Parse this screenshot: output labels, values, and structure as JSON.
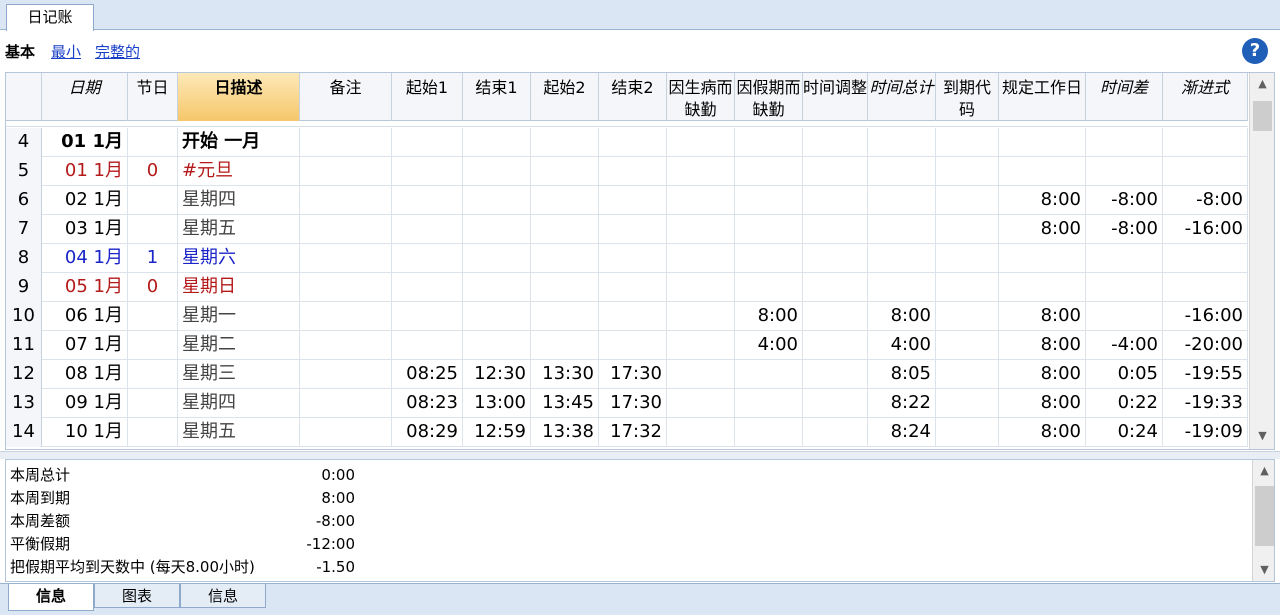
{
  "doc_tab": "日记账",
  "views": {
    "basic": "基本",
    "min": "最小",
    "full": "完整的"
  },
  "help_symbol": "?",
  "headers": {
    "date": "日期",
    "holiday": "节日",
    "desc": "日描述",
    "note": "备注",
    "start1": "起始1",
    "end1": "结束1",
    "start2": "起始2",
    "end2": "结束2",
    "sick": "因生病而缺勤",
    "vacation": "因假期而缺勤",
    "adjust": "时间调整",
    "total": "时间总计",
    "due_code": "到期代码",
    "workday": "规定工作日",
    "diff": "时间差",
    "progressive": "渐进式"
  },
  "rows": [
    {
      "num": "4",
      "date": "01 1月",
      "holiday": "",
      "desc": "开始 一月",
      "start1": "",
      "end1": "",
      "start2": "",
      "end2": "",
      "sick": "",
      "vacation": "",
      "adjust": "",
      "total": "",
      "due_code": "",
      "workday": "",
      "diff": "",
      "progressive": ""
    },
    {
      "num": "5",
      "date": "01 1月",
      "holiday": "0",
      "desc": "#元旦",
      "start1": "",
      "end1": "",
      "start2": "",
      "end2": "",
      "sick": "",
      "vacation": "",
      "adjust": "",
      "total": "",
      "due_code": "",
      "workday": "",
      "diff": "",
      "progressive": ""
    },
    {
      "num": "6",
      "date": "02 1月",
      "holiday": "",
      "desc": "星期四",
      "start1": "",
      "end1": "",
      "start2": "",
      "end2": "",
      "sick": "",
      "vacation": "",
      "adjust": "",
      "total": "",
      "due_code": "",
      "workday": "8:00",
      "diff": "-8:00",
      "progressive": "-8:00"
    },
    {
      "num": "7",
      "date": "03 1月",
      "holiday": "",
      "desc": "星期五",
      "start1": "",
      "end1": "",
      "start2": "",
      "end2": "",
      "sick": "",
      "vacation": "",
      "adjust": "",
      "total": "",
      "due_code": "",
      "workday": "8:00",
      "diff": "-8:00",
      "progressive": "-16:00"
    },
    {
      "num": "8",
      "date": "04 1月",
      "holiday": "1",
      "desc": "星期六",
      "start1": "",
      "end1": "",
      "start2": "",
      "end2": "",
      "sick": "",
      "vacation": "",
      "adjust": "",
      "total": "",
      "due_code": "",
      "workday": "",
      "diff": "",
      "progressive": ""
    },
    {
      "num": "9",
      "date": "05 1月",
      "holiday": "0",
      "desc": "星期日",
      "start1": "",
      "end1": "",
      "start2": "",
      "end2": "",
      "sick": "",
      "vacation": "",
      "adjust": "",
      "total": "",
      "due_code": "",
      "workday": "",
      "diff": "",
      "progressive": ""
    },
    {
      "num": "10",
      "date": "06 1月",
      "holiday": "",
      "desc": "星期一",
      "start1": "",
      "end1": "",
      "start2": "",
      "end2": "",
      "sick": "",
      "vacation": "8:00",
      "adjust": "",
      "total": "8:00",
      "due_code": "",
      "workday": "8:00",
      "diff": "",
      "progressive": "-16:00"
    },
    {
      "num": "11",
      "date": "07 1月",
      "holiday": "",
      "desc": "星期二",
      "start1": "",
      "end1": "",
      "start2": "",
      "end2": "",
      "sick": "",
      "vacation": "4:00",
      "adjust": "",
      "total": "4:00",
      "due_code": "",
      "workday": "8:00",
      "diff": "-4:00",
      "progressive": "-20:00"
    },
    {
      "num": "12",
      "date": "08 1月",
      "holiday": "",
      "desc": "星期三",
      "start1": "08:25",
      "end1": "12:30",
      "start2": "13:30",
      "end2": "17:30",
      "sick": "",
      "vacation": "",
      "adjust": "",
      "total": "8:05",
      "due_code": "",
      "workday": "8:00",
      "diff": "0:05",
      "progressive": "-19:55"
    },
    {
      "num": "13",
      "date": "09 1月",
      "holiday": "",
      "desc": "星期四",
      "start1": "08:23",
      "end1": "13:00",
      "start2": "13:45",
      "end2": "17:30",
      "sick": "",
      "vacation": "",
      "adjust": "",
      "total": "8:22",
      "due_code": "",
      "workday": "8:00",
      "diff": "0:22",
      "progressive": "-19:33"
    },
    {
      "num": "14",
      "date": "10 1月",
      "holiday": "",
      "desc": "星期五",
      "start1": "08:29",
      "end1": "12:59",
      "start2": "13:38",
      "end2": "17:32",
      "sick": "",
      "vacation": "",
      "adjust": "",
      "total": "8:24",
      "due_code": "",
      "workday": "8:00",
      "diff": "0:24",
      "progressive": "-19:09"
    }
  ],
  "info": [
    {
      "label": "本周总计",
      "value": "0:00"
    },
    {
      "label": "本周到期",
      "value": "8:00"
    },
    {
      "label": "本周差额",
      "value": "-8:00"
    },
    {
      "label": "平衡假期",
      "value": "-12:00"
    },
    {
      "label": "把假期平均到天数中 (每天8.00小时)",
      "value": "-1.50"
    }
  ],
  "bottom_tabs": [
    "信息",
    "图表",
    "信息"
  ],
  "colors": {
    "accent": "#f6c76a",
    "holiday_red": "#b41a1a",
    "weekend_blue": "#1a24c8",
    "band": "#dae6f4"
  }
}
